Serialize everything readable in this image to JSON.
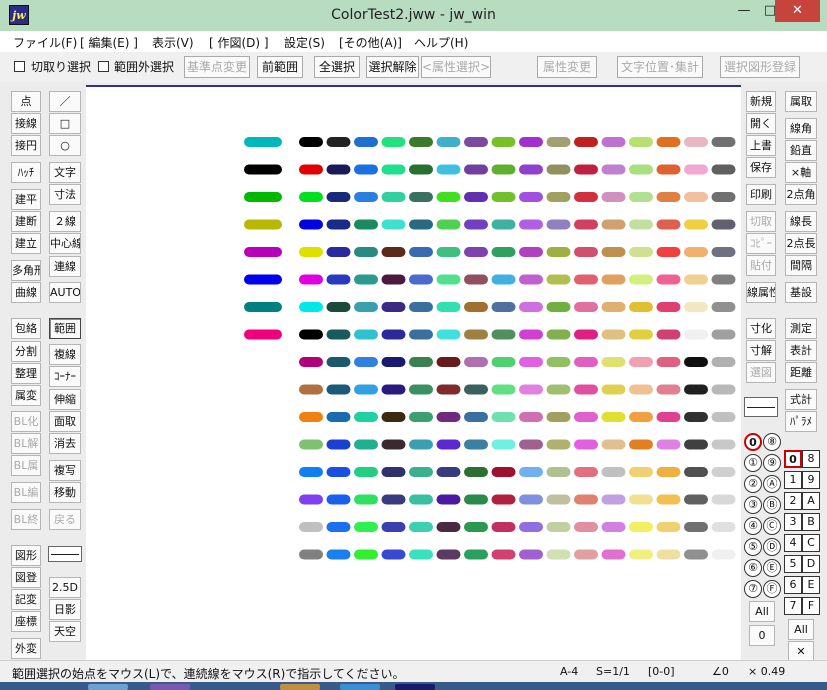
{
  "titlebar": {
    "app_icon": "jw",
    "title": "ColorTest2.jww - jw_win",
    "minimize": "—",
    "maximize": "□",
    "close": "✕"
  },
  "menu": [
    "ファイル(F)",
    "[ 編集(E) ]",
    "表示(V)",
    "[ 作図(D) ]",
    "設定(S)",
    "[その他(A)]",
    "ヘルプ(H)"
  ],
  "toolbar": {
    "cut_select": "切取り選択",
    "outside_select": "範囲外選択",
    "base_change": "基準点変更",
    "prev_range": "前範囲",
    "select_all": "全選択",
    "deselect": "選択解除",
    "attr_select": "<属性選択>",
    "attr_change": "属性変更",
    "text_pos": "文字位置･集計",
    "register_shape": "選択図形登録"
  },
  "left_col1": [
    "点",
    "接線",
    "接円",
    "ﾊｯﾁ",
    "建平",
    "建断",
    "建立",
    "多角形",
    "曲線",
    "包絡",
    "分割",
    "整理",
    "属変",
    "BL化",
    "BL解",
    "BL属",
    "BL編",
    "BL終",
    "図形",
    "図登",
    "記変",
    "座標",
    "外変"
  ],
  "left_col2": [
    "／",
    "□",
    "○",
    "文字",
    "寸法",
    "２線",
    "中心線",
    "連線",
    "AUTO",
    "範囲",
    "複線",
    "ｺｰﾅｰ",
    "伸縮",
    "面取",
    "消去",
    "複写",
    "移動",
    "戻る",
    "2.5D",
    "日影",
    "天空"
  ],
  "right_col1": [
    "新規",
    "開く",
    "上書",
    "保存",
    "印刷",
    "切取",
    "ｺﾋﾟｰ",
    "貼付",
    "線属性",
    "寸化",
    "寸解",
    "選図"
  ],
  "right_col2": [
    "属取",
    "線角",
    "鉛直",
    "×軸",
    "2点角",
    "線長",
    "2点長",
    "間隔",
    "基設",
    "測定",
    "表計",
    "距離",
    "式計",
    "ﾊﾟﾗﾒ"
  ],
  "layer_groups": [
    "0",
    "①",
    "②",
    "③",
    "④",
    "⑤",
    "⑥",
    "⑦",
    "⑧",
    "⑨",
    "Ⓐ",
    "Ⓑ",
    "Ⓒ",
    "Ⓓ",
    "Ⓔ",
    "Ⓕ"
  ],
  "layers": [
    "0",
    "1",
    "2",
    "3",
    "4",
    "5",
    "6",
    "7",
    "8",
    "9",
    "A",
    "B",
    "C",
    "D",
    "E",
    "F"
  ],
  "all_label": "All",
  "zero_label": "0",
  "close_x": "✕",
  "status": {
    "message": "範囲選択の始点をマウス(L)で、連続線をマウス(R)で指示してください。",
    "paper": "A-4",
    "scale": "S=1/1",
    "layer": "[0-0]",
    "angle": "∠0",
    "zoom": "× 0.49"
  },
  "palette": {
    "left": [
      "#00b8bc",
      "#000000",
      "#00b800",
      "#b8b800",
      "#b800b8",
      "#0000f0",
      "#008080",
      "#f0007c"
    ],
    "rows": [
      [
        "#000000",
        "#222222",
        "#1e6fd0",
        "#20e080",
        "#3a7a2a",
        "#3fb0c8",
        "#7a4aa0",
        "#78c028",
        "#a030d0",
        "#a0a070",
        "#c02020",
        "#c070d0",
        "#b8e070",
        "#e07020",
        "#e8b8c0",
        "#707070"
      ],
      [
        "#e00000",
        "#1a1a5a",
        "#1a70e0",
        "#20e090",
        "#287030",
        "#40c0e0",
        "#7040a0",
        "#60b030",
        "#9040d0",
        "#909060",
        "#c02040",
        "#c080d0",
        "#a8e080",
        "#e06030",
        "#f0a8d0",
        "#606060"
      ],
      [
        "#00e020",
        "#1a2a7a",
        "#2a80e0",
        "#30d0a0",
        "#3a7060",
        "#40e020",
        "#6030b0",
        "#70c030",
        "#a050e0",
        "#a0a060",
        "#d03040",
        "#d090c0",
        "#b0e090",
        "#e08040",
        "#f0c0a0",
        "#707070"
      ],
      [
        "#0000e0",
        "#1a2a8a",
        "#1a8a60",
        "#40e0d0",
        "#2a6a80",
        "#50d050",
        "#7040c0",
        "#40b0a0",
        "#b060e0",
        "#9080c0",
        "#d04060",
        "#d0a070",
        "#c0e0a0",
        "#e06050",
        "#f0d040",
        "#606070"
      ],
      [
        "#e0e000",
        "#2a2aa0",
        "#2a8a80",
        "#5a2a1a",
        "#3a6ab0",
        "#40c080",
        "#8040b0",
        "#30a060",
        "#b040c0",
        "#a0b040",
        "#d05070",
        "#c09050",
        "#d0e090",
        "#f04040",
        "#f0b070",
        "#707080"
      ],
      [
        "#e000e0",
        "#2a3ac0",
        "#2a9a90",
        "#4a1a40",
        "#4a6ad0",
        "#50e090",
        "#905060",
        "#40b0e0",
        "#c060d0",
        "#b0c050",
        "#e06070",
        "#e0a060",
        "#d0f080",
        "#f06090",
        "#f0d090",
        "#808080"
      ],
      [
        "#00e8e8",
        "#1a4a3a",
        "#3aa0b0",
        "#3a2a80",
        "#3a70a0",
        "#30e0b0",
        "#a07030",
        "#5070a0",
        "#d070e0",
        "#70b040",
        "#e070a0",
        "#e0b070",
        "#e0c030",
        "#e04070",
        "#f0e8c0",
        "#909090"
      ],
      [
        "#000000",
        "#1a5a5a",
        "#30c0d0",
        "#2a2a9a",
        "#3a70a0",
        "#40e0e0",
        "#a08040",
        "#509060",
        "#d040d0",
        "#80b050",
        "#e02080",
        "#e0c080",
        "#e0d040",
        "#d04070",
        "#f0f0f0",
        "#a0a0a0"
      ],
      [
        "#b0007a",
        "#1a5a6a",
        "#3080e0",
        "#1a1a70",
        "#3a8050",
        "#6a1a1a",
        "#b070b0",
        "#50d070",
        "#e060e0",
        "#90c060",
        "#e060c0",
        "#e0e070",
        "#f0a0b0",
        "#e06080",
        "#101010",
        "#b0b0b0"
      ],
      [
        "#b07040",
        "#1a5a7a",
        "#30a0e0",
        "#2a1a80",
        "#3a9060",
        "#802a2a",
        "#3a6060",
        "#60e080",
        "#e080e0",
        "#a0c070",
        "#e050a0",
        "#e0d050",
        "#f0c090",
        "#e08090",
        "#202020",
        "#b8b8b8"
      ],
      [
        "#f08010",
        "#1a6ab0",
        "#20d0a0",
        "#3a2a10",
        "#3aa070",
        "#702a80",
        "#3a70a0",
        "#70e0b0",
        "#d070b0",
        "#a0a060",
        "#e060d0",
        "#e0e030",
        "#f0a040",
        "#e04090",
        "#303030",
        "#c0c0c0"
      ],
      [
        "#80c070",
        "#1a40d0",
        "#20b090",
        "#3a2a30",
        "#3aa0b0",
        "#5a2ad0",
        "#3a80a0",
        "#70f0e0",
        "#a06090",
        "#b0b070",
        "#e060e0",
        "#e0c090",
        "#e08020",
        "#e080e0",
        "#404040",
        "#c8c8c8"
      ],
      [
        "#1080f0",
        "#1a50e0",
        "#20d080",
        "#303070",
        "#3ab090",
        "#3a3a80",
        "#2a7030",
        "#a01030",
        "#70b0f0",
        "#b0c090",
        "#e07080",
        "#c0c0c0",
        "#f0d070",
        "#f0b040",
        "#505050",
        "#d0d0d0"
      ],
      [
        "#8040f0",
        "#1a60f0",
        "#30e060",
        "#3a3a80",
        "#3ac0a0",
        "#4a1aa0",
        "#2a8a4a",
        "#b02040",
        "#8090e0",
        "#c0c0a0",
        "#e08070",
        "#c0a0e0",
        "#f0e090",
        "#f0c050",
        "#606060",
        "#d8d8d8"
      ],
      [
        "#c0c0c0",
        "#1a70f0",
        "#30f050",
        "#3a40b0",
        "#3ad0b0",
        "#4a2a40",
        "#2a9a50",
        "#c03060",
        "#9070e0",
        "#c0d0a0",
        "#e090a0",
        "#d080e0",
        "#f0f060",
        "#f0d070",
        "#707070",
        "#e0e0e0"
      ],
      [
        "#808080",
        "#1a80f0",
        "#30f030",
        "#3a4ad0",
        "#3ae0c0",
        "#5a3a60",
        "#2aa060",
        "#d04070",
        "#a060d0",
        "#d0e0b0",
        "#e0a0a0",
        "#e070d0",
        "#f0f080",
        "#f0e0a0",
        "#909090",
        "#f0f0f0"
      ]
    ]
  }
}
